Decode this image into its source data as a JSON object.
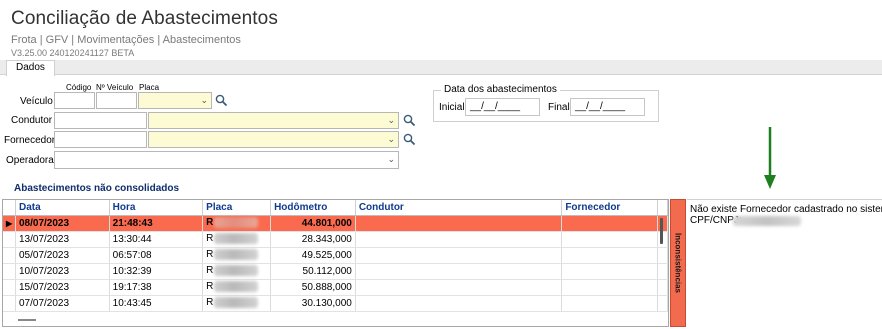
{
  "header": {
    "title": "Conciliação de Abastecimentos",
    "breadcrumb": "Frota | GFV | Movimentações | Abastecimentos",
    "version": "V3.25.00 240120241127 BETA"
  },
  "tabs": [
    {
      "label": "Dados"
    }
  ],
  "form": {
    "veiculo_label": "Veículo",
    "codigo_label": "Código",
    "nveiculo_label": "Nº Veículo",
    "placa_label": "Placa",
    "condutor_label": "Condutor",
    "fornecedor_label": "Fornecedor",
    "operadora_label": "Operadora"
  },
  "dates": {
    "group_label": "Data dos abastecimentos",
    "inicial_label": "Inicial",
    "inicial_value": "__/__/____",
    "final_label": "Final",
    "final_value": "__/__/____"
  },
  "grid": {
    "section_title": "Abastecimentos não consolidados",
    "columns": [
      "Data",
      "Hora",
      "Placa",
      "Hodômetro",
      "Condutor",
      "Fornecedor"
    ],
    "selected_row": 0,
    "rows": [
      {
        "data": "08/07/2023",
        "hora": "21:48:43",
        "placa": "R",
        "hodometro": "44.801,000",
        "condutor": "",
        "fornecedor": ""
      },
      {
        "data": "13/07/2023",
        "hora": "13:30:44",
        "placa": "R",
        "hodometro": "28.343,000",
        "condutor": "",
        "fornecedor": ""
      },
      {
        "data": "05/07/2023",
        "hora": "06:57:08",
        "placa": "R",
        "hodometro": "49.525,000",
        "condutor": "",
        "fornecedor": ""
      },
      {
        "data": "10/07/2023",
        "hora": "10:32:39",
        "placa": "R",
        "hodometro": "50.112,000",
        "condutor": "",
        "fornecedor": ""
      },
      {
        "data": "15/07/2023",
        "hora": "19:17:38",
        "placa": "R",
        "hodometro": "50.888,000",
        "condutor": "",
        "fornecedor": ""
      },
      {
        "data": "07/07/2023",
        "hora": "10:43:45",
        "placa": "R",
        "hodometro": "30.130,000",
        "condutor": "",
        "fornecedor": ""
      }
    ]
  },
  "inconsistencias": {
    "tab_label": "Inconsistências",
    "message_line1": "Não existe Fornecedor cadastrado no sistema.",
    "message_line2_label": "CPF/CNPJ:"
  },
  "colors": {
    "selected_row": "#fa6a4f",
    "sidebar": "#f26b4f",
    "lookup_field": "#fdfbd4",
    "column_header_text": "#0f3b8f",
    "section_title_text": "#0f2d6b",
    "annotation_arrow": "#1e7f1e"
  },
  "icons": {
    "lookup": "magnifier-icon",
    "dropdown": "chevron-down-icon",
    "row_indicator": "triangle-right-icon",
    "annotation": "arrow-down-icon"
  }
}
